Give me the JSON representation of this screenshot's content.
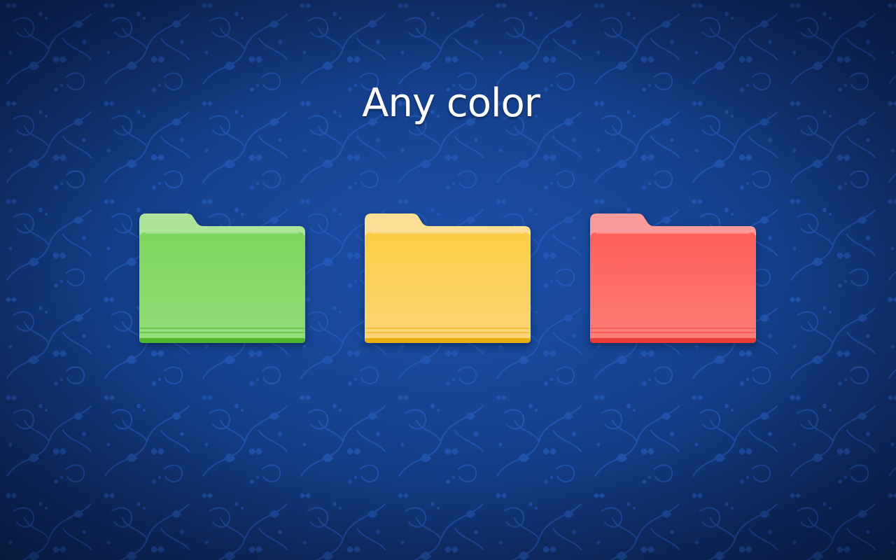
{
  "headline": "Any color",
  "folders": [
    {
      "name": "green",
      "back": "#aee39a",
      "front_top": "#7dd55e",
      "front_bottom": "#93dd78",
      "edge": "#5fc23c",
      "bottom_line": "#4fb52d"
    },
    {
      "name": "yellow",
      "back": "#fcdf96",
      "front_top": "#fbcd45",
      "front_bottom": "#fbd678",
      "edge": "#f2bc24",
      "bottom_line": "#e8ad10"
    },
    {
      "name": "red",
      "back": "#fc9c9a",
      "front_top": "#fd5f5a",
      "front_bottom": "#fd7d79",
      "edge": "#f44f49",
      "bottom_line": "#ea3b35"
    }
  ],
  "background": {
    "base": "#16408d",
    "pattern": "#2a63c9"
  }
}
